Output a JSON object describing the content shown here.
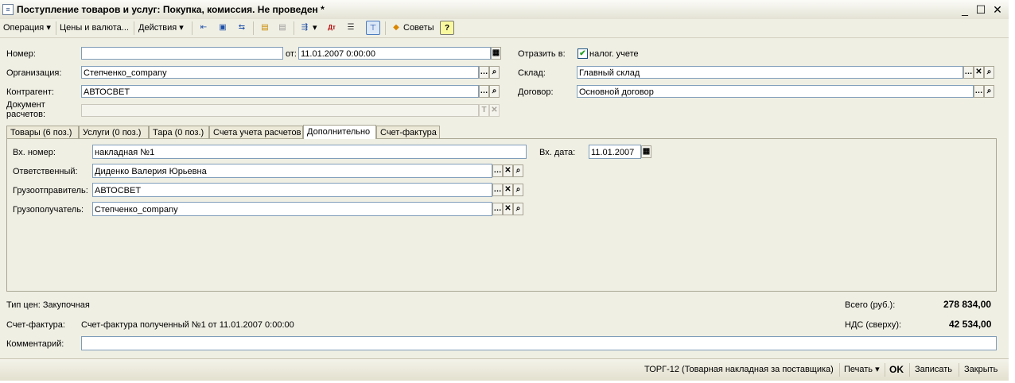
{
  "title": "Поступление товаров и услуг: Покупка, комиссия. Не проведен *",
  "toolbar": {
    "operation": "Операция",
    "prices": "Цены и валюта...",
    "actions": "Действия",
    "tips": "Советы",
    "help": "?"
  },
  "header": {
    "number_label": "Номер:",
    "number_value": "",
    "date_label": "от:",
    "date_value": "11.01.2007  0:00:00",
    "reflect_label": "Отразить в:",
    "tax_label": "налог. учете",
    "org_label": "Организация:",
    "org_value": "Степченко_company",
    "warehouse_label": "Склад:",
    "warehouse_value": "Главный склад",
    "contractor_label": "Контрагент:",
    "contractor_value": "АВТОСВЕТ",
    "contract_label": "Договор:",
    "contract_value": "Основной договор",
    "settle_doc_label_1": "Документ",
    "settle_doc_label_2": "расчетов:",
    "settle_doc_value": ""
  },
  "tabs": [
    {
      "label": "Товары (6 поз.)"
    },
    {
      "label": "Услуги (0 поз.)"
    },
    {
      "label": "Тара (0 поз.)"
    },
    {
      "label": "Счета учета расчетов"
    },
    {
      "label": "Дополнительно"
    },
    {
      "label": "Счет-фактура"
    }
  ],
  "extra": {
    "in_number_label": "Вх. номер:",
    "in_number_value": "накладная №1",
    "in_date_label": "Вх. дата:",
    "in_date_value": "11.01.2007",
    "responsible_label": "Ответственный:",
    "responsible_value": "Диденко Валерия Юрьевна",
    "shipper_label": "Грузоотправитель:",
    "shipper_value": "АВТОСВЕТ",
    "consignee_label": "Грузополучатель:",
    "consignee_value": "Степченко_company"
  },
  "footer": {
    "price_type": "Тип цен: Закупочная",
    "total_label": "Всего (руб.):",
    "total_value": "278 834,00",
    "invoice_label": "Счет-фактура:",
    "invoice_value": "Счет-фактура полученный №1 от 11.01.2007 0:00:00",
    "vat_label": "НДС (сверху):",
    "vat_value": "42 534,00",
    "comment_label": "Комментарий:",
    "comment_value": ""
  },
  "statusbar": {
    "torg": "ТОРГ-12 (Товарная накладная за поставщика)",
    "print": "Печать",
    "ok": "OK",
    "save": "Записать",
    "close": "Закрыть"
  },
  "colors": {
    "window_bg": "#f0efe4",
    "field_border": "#7f9db9"
  },
  "icons": {
    "min": "minimize-icon",
    "max": "maximize-icon",
    "close": "close-icon"
  }
}
